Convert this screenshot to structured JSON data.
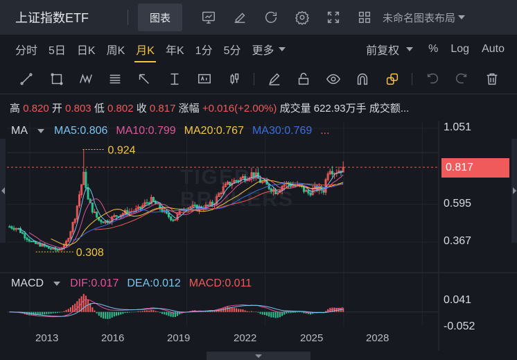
{
  "titlebar": {
    "title": "上证指数ETF",
    "tab_chart": "图表",
    "layout_name": "未命名图表布局"
  },
  "periods": [
    "分时",
    "5日",
    "日K",
    "周K",
    "月K",
    "年K",
    "1分",
    "5分",
    "更多"
  ],
  "active_period": "月K",
  "period_right": {
    "adjust": "前复权",
    "percent": "%",
    "log": "Log",
    "auto": "Auto"
  },
  "quote": {
    "high_label": "高",
    "high": "0.820",
    "open_label": "开",
    "open": "0.803",
    "low_label": "低",
    "low": "0.802",
    "close_label": "收",
    "close": "0.817",
    "change_label": "涨幅",
    "change": "+0.016(+2.00%)",
    "volume_label": "成交量",
    "volume": "622.93万手",
    "amount_label": "成交额..."
  },
  "ma_legend": {
    "name": "MA",
    "ma5": "MA5:0.806",
    "ma10": "MA10:0.799",
    "ma20": "MA20:0.767",
    "ma30": "MA30:0.769",
    "more": "..."
  },
  "macd_legend": {
    "name": "MACD",
    "dif": "DIF:0.017",
    "dea": "DEA:0.012",
    "macd": "MACD:0.011"
  },
  "price_axis": [
    "1.051",
    "0.595",
    "0.367"
  ],
  "current_price": "0.817",
  "macd_axis": [
    "0.041",
    "-0.052"
  ],
  "x_axis": [
    "2013",
    "2016",
    "2019",
    "2022",
    "2025",
    "2028"
  ],
  "annotations": {
    "high": "0.924",
    "low": "0.308"
  },
  "watermark": [
    "TIGER",
    "BROKERS"
  ],
  "colors": {
    "up": "#f05a5a",
    "down": "#2ebf8f",
    "ma5": "#7cc4f2",
    "ma10": "#e0559b",
    "ma20": "#f5c542",
    "ma30": "#3c6fe0",
    "accent": "#f5c542"
  },
  "chart_data": {
    "type": "candlestick",
    "period": "monthly",
    "x_range": [
      2012.5,
      2029.0
    ],
    "y_range": [
      0.3,
      1.051
    ],
    "current": 0.817,
    "high_point": {
      "year": 2015.4,
      "value": 0.924
    },
    "low_point": {
      "year": 2014.4,
      "value": 0.308
    },
    "close_path": [
      [
        2012.6,
        0.46
      ],
      [
        2012.9,
        0.45
      ],
      [
        2013.2,
        0.4
      ],
      [
        2013.5,
        0.36
      ],
      [
        2013.8,
        0.35
      ],
      [
        2014.1,
        0.33
      ],
      [
        2014.4,
        0.32
      ],
      [
        2014.7,
        0.34
      ],
      [
        2014.9,
        0.42
      ],
      [
        2015.1,
        0.52
      ],
      [
        2015.3,
        0.68
      ],
      [
        2015.45,
        0.78
      ],
      [
        2015.6,
        0.62
      ],
      [
        2015.8,
        0.55
      ],
      [
        2016.0,
        0.5
      ],
      [
        2016.3,
        0.49
      ],
      [
        2016.6,
        0.52
      ],
      [
        2016.9,
        0.54
      ],
      [
        2017.2,
        0.55
      ],
      [
        2017.5,
        0.56
      ],
      [
        2017.8,
        0.6
      ],
      [
        2018.0,
        0.62
      ],
      [
        2018.3,
        0.58
      ],
      [
        2018.6,
        0.53
      ],
      [
        2018.9,
        0.5
      ],
      [
        2019.2,
        0.57
      ],
      [
        2019.5,
        0.58
      ],
      [
        2019.8,
        0.57
      ],
      [
        2020.1,
        0.58
      ],
      [
        2020.4,
        0.6
      ],
      [
        2020.7,
        0.68
      ],
      [
        2021.0,
        0.72
      ],
      [
        2021.3,
        0.74
      ],
      [
        2021.6,
        0.76
      ],
      [
        2021.9,
        0.78
      ],
      [
        2022.2,
        0.73
      ],
      [
        2022.5,
        0.7
      ],
      [
        2022.8,
        0.67
      ],
      [
        2023.1,
        0.72
      ],
      [
        2023.4,
        0.71
      ],
      [
        2023.7,
        0.7
      ],
      [
        2024.0,
        0.66
      ],
      [
        2024.3,
        0.69
      ],
      [
        2024.6,
        0.68
      ],
      [
        2024.8,
        0.82
      ],
      [
        2025.0,
        0.79
      ],
      [
        2025.2,
        0.8
      ],
      [
        2025.4,
        0.817
      ]
    ],
    "macd": {
      "dif": 0.017,
      "dea": 0.012,
      "macd": 0.011,
      "y_range": [
        -0.052,
        0.041
      ]
    }
  }
}
